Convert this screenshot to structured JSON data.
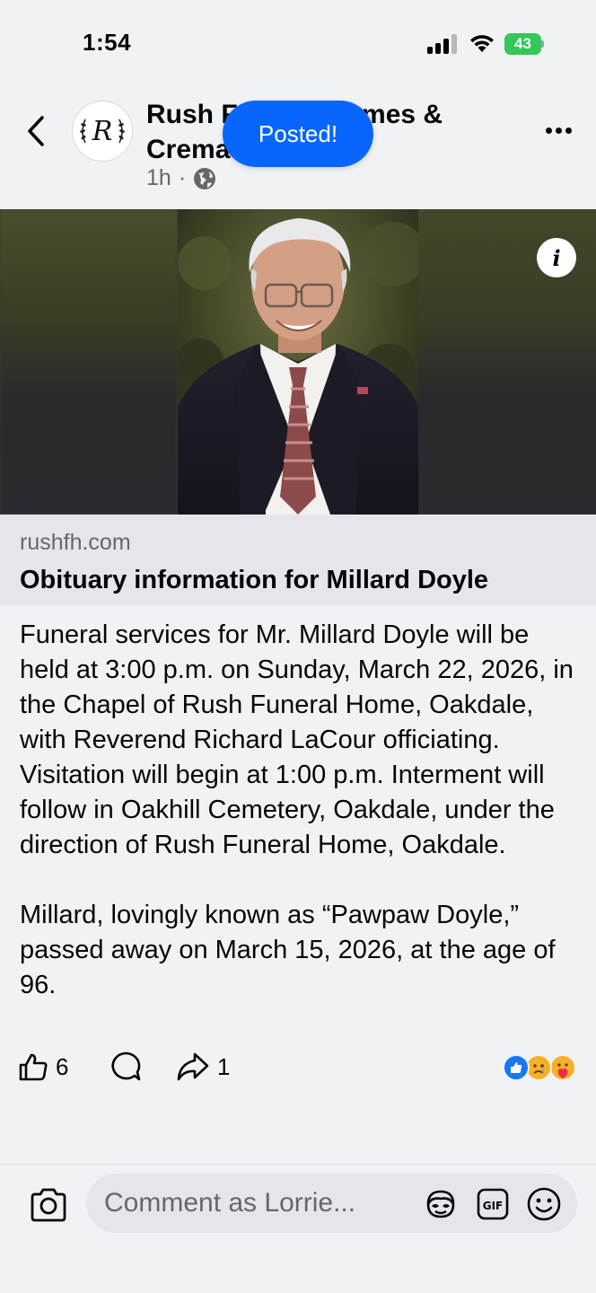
{
  "status_bar": {
    "time": "1:54",
    "battery": "43"
  },
  "header": {
    "page_name": "Rush Funeral Homes & Crematory",
    "time_ago": "1h",
    "separator": "·",
    "toast": "Posted!"
  },
  "link": {
    "domain": "rushfh.com",
    "title": "Obituary information for Millard Doyle"
  },
  "post": {
    "paragraphs": [
      "Funeral services for Mr. Millard Doyle will be held at 3:00 p.m. on Sunday, March 22, 2026, in the Chapel of Rush Funeral Home, Oakdale, with Reverend Richard LaCour officiating. Visitation will begin at 1:00 p.m. Interment will follow in Oakhill Cemetery, Oakdale, under the direction of Rush Funeral Home, Oakdale.",
      "Millard, lovingly known as “Pawpaw Doyle,” passed away on March 15, 2026, at the age of 96."
    ]
  },
  "actions": {
    "like_count": "6",
    "share_count": "1",
    "reactions": [
      "like",
      "sad",
      "care"
    ]
  },
  "comment": {
    "placeholder": "Comment as Lorrie..."
  },
  "colors": {
    "accent": "#0866ff",
    "background": "#f0f2f5",
    "link_box": "#e4e6eb",
    "secondary_text": "#65676b"
  },
  "icons": [
    "back-chevron-icon",
    "globe-icon",
    "more-icon",
    "info-icon",
    "like-icon",
    "comment-icon",
    "share-icon",
    "camera-icon",
    "avatar-sticker-icon",
    "gif-icon",
    "emoji-icon"
  ]
}
